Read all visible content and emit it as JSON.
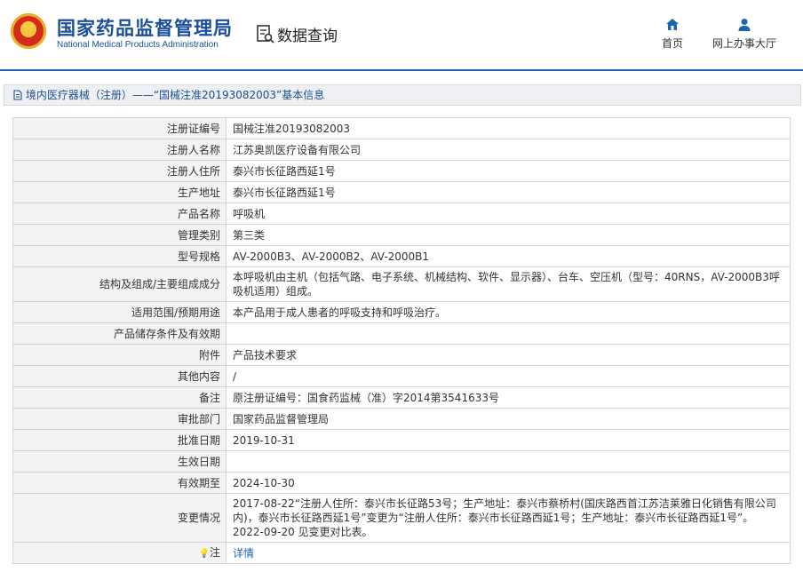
{
  "header": {
    "brand_cn": "国家药品监督管理局",
    "brand_en": "National Medical Products Administration",
    "query_label": "数据查询",
    "nav": {
      "home": "首页",
      "hall": "网上办事大厅"
    }
  },
  "breadcrumb": "境内医疗器械（注册）——“国械注准20193082003”基本信息",
  "rows": [
    {
      "key": "注册证编号",
      "value": "国械注准20193082003"
    },
    {
      "key": "注册人名称",
      "value": "江苏奥凯医疗设备有限公司"
    },
    {
      "key": "注册人住所",
      "value": "泰兴市长征路西延1号"
    },
    {
      "key": "生产地址",
      "value": "泰兴市长征路西延1号"
    },
    {
      "key": "产品名称",
      "value": "呼吸机"
    },
    {
      "key": "管理类别",
      "value": "第三类"
    },
    {
      "key": "型号规格",
      "value": "AV-2000B3、AV-2000B2、AV-2000B1"
    },
    {
      "key": "结构及组成/主要组成成分",
      "value": "本呼吸机由主机（包括气路、电子系统、机械结构、软件、显示器）、台车、空压机（型号：40RNS，AV-2000B3呼吸机适用）组成。"
    },
    {
      "key": "适用范围/预期用途",
      "value": "本产品用于成人患者的呼吸支持和呼吸治疗。"
    },
    {
      "key": "产品储存条件及有效期",
      "value": ""
    },
    {
      "key": "附件",
      "value": "产品技术要求"
    },
    {
      "key": "其他内容",
      "value": "/"
    },
    {
      "key": "备注",
      "value": "原注册证编号：国食药监械（准）字2014第3541633号"
    },
    {
      "key": "审批部门",
      "value": "国家药品监督管理局"
    },
    {
      "key": "批准日期",
      "value": "2019-10-31"
    },
    {
      "key": "生效日期",
      "value": ""
    },
    {
      "key": "有效期至",
      "value": "2024-10-30"
    },
    {
      "key": "变更情况",
      "value": "2017-08-22“注册人住所：泰兴市长征路53号；生产地址：泰兴市蔡桥村(国庆路西首江苏洁莱雅日化销售有限公司内)，泰兴市长征路西延1号”变更为“注册人住所：泰兴市长征路西延1号；生产地址：泰兴市长征路西延1号”。 2022-09-20 见变更对比表。"
    }
  ],
  "note": {
    "key": "注",
    "link": "详情"
  }
}
